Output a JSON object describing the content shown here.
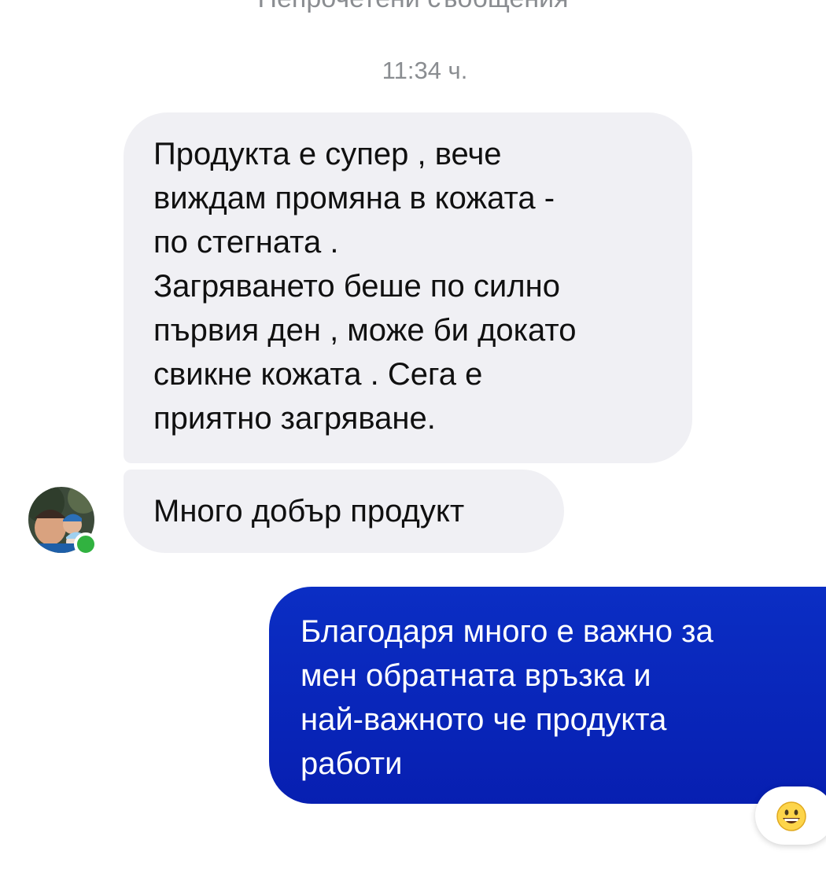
{
  "header": {
    "unread_label": "Непрочетени съобщения"
  },
  "conversation": {
    "timestamp": "11:34 ч.",
    "messages": [
      {
        "direction": "incoming",
        "text": "Продукта е супер , вече\nвиждам промяна в кожата -\nпо стегната .\nЗагряването беше по силно\nпървия ден , може би докато\nсвикне кожата . Сега е\nприятно загряване."
      },
      {
        "direction": "incoming",
        "text": "Много добър продукт"
      },
      {
        "direction": "outgoing",
        "text": "Благодаря много е важно за\nмен обратната връзка и\nнай-важното че продукта\nработи",
        "reaction": "grinning-face-emoji"
      }
    ]
  },
  "colors": {
    "incoming_bubble": "#f0f0f4",
    "outgoing_bubble": "#0a2ab8",
    "online_indicator": "#31b240",
    "timestamp_text": "#8a8d91"
  }
}
